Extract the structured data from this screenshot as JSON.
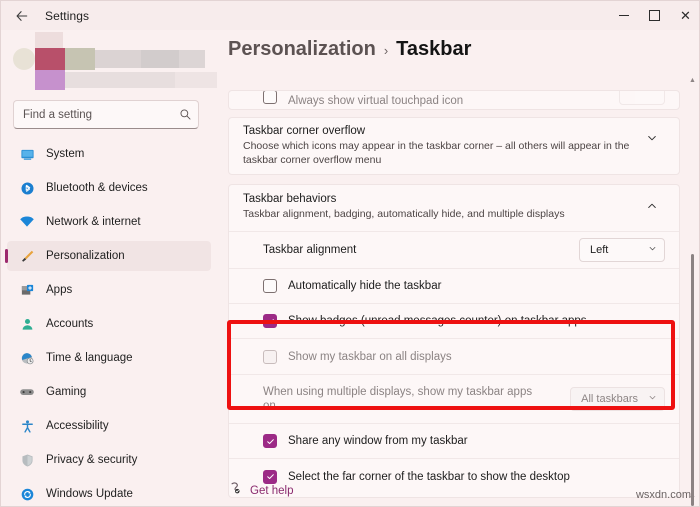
{
  "window": {
    "app_title": "Settings",
    "back_icon": "back-arrow-icon",
    "minimize_label": "Minimize",
    "maximize_label": "Maximize",
    "close_label": "Close"
  },
  "sidebar": {
    "search": {
      "placeholder": "Find a setting",
      "value": "",
      "icon": "search-icon"
    },
    "items": [
      {
        "label": "System",
        "icon": "monitor-icon",
        "selected": false
      },
      {
        "label": "Bluetooth & devices",
        "icon": "bluetooth-icon",
        "selected": false
      },
      {
        "label": "Network & internet",
        "icon": "wifi-icon",
        "selected": false
      },
      {
        "label": "Personalization",
        "icon": "paintbrush-icon",
        "selected": true
      },
      {
        "label": "Apps",
        "icon": "apps-icon",
        "selected": false
      },
      {
        "label": "Accounts",
        "icon": "person-icon",
        "selected": false
      },
      {
        "label": "Time & language",
        "icon": "clock-globe-icon",
        "selected": false
      },
      {
        "label": "Gaming",
        "icon": "gamepad-icon",
        "selected": false
      },
      {
        "label": "Accessibility",
        "icon": "accessibility-icon",
        "selected": false
      },
      {
        "label": "Privacy & security",
        "icon": "shield-icon",
        "selected": false
      },
      {
        "label": "Windows Update",
        "icon": "update-icon",
        "selected": false
      }
    ]
  },
  "header": {
    "breadcrumb_parent": "Personalization",
    "breadcrumb_separator": "›",
    "breadcrumb_current": "Taskbar"
  },
  "content": {
    "partial_row_top": {
      "label": "Always show virtual touchpad icon"
    },
    "corner_overflow": {
      "title": "Taskbar corner overflow",
      "subtitle": "Choose which icons may appear in the taskbar corner – all others will appear in the taskbar corner overflow menu",
      "expander_icon": "chevron-down-icon"
    },
    "behaviors": {
      "title": "Taskbar behaviors",
      "subtitle": "Taskbar alignment, badging, automatically hide, and multiple displays",
      "expander_icon": "chevron-up-icon",
      "rows": [
        {
          "type": "dropdown",
          "label": "Taskbar alignment",
          "value": "Left",
          "disabled": false,
          "chevron_icon": "chevron-down-icon"
        },
        {
          "type": "checkbox",
          "label": "Automatically hide the taskbar",
          "checked": false,
          "disabled": false
        },
        {
          "type": "checkbox",
          "label": "Show badges (unread messages counter) on taskbar apps",
          "checked": true,
          "disabled": false
        },
        {
          "type": "checkbox",
          "label": "Show my taskbar on all displays",
          "checked": false,
          "disabled": true,
          "highlighted": true
        },
        {
          "type": "dropdown",
          "label": "When using multiple displays, show my taskbar apps on",
          "value": "All taskbars",
          "disabled": true,
          "highlighted": true,
          "chevron_icon": "chevron-down-icon"
        },
        {
          "type": "checkbox",
          "label": "Share any window from my taskbar",
          "checked": true,
          "disabled": false
        },
        {
          "type": "checkbox",
          "label": "Select the far corner of the taskbar to show the desktop",
          "checked": true,
          "disabled": false
        }
      ]
    }
  },
  "footer": {
    "help_label": "Get help",
    "help_icon": "help-question-icon"
  },
  "scrollbar": {
    "up_arrow_icon": "caret-up-icon",
    "down_arrow_icon": "caret-down-icon"
  },
  "annotation": {
    "color": "#ee1111",
    "target": "multiple-displays-settings"
  },
  "watermark": {
    "text": "wsxdn.com"
  },
  "colors": {
    "accent": "#9c2a86",
    "selection_bar": "#9c2a6e",
    "window_bg": "#faf0f0",
    "card_bg": "#fdf7f7",
    "annotation_red": "#ee1111",
    "link": "#8a2a6e"
  }
}
